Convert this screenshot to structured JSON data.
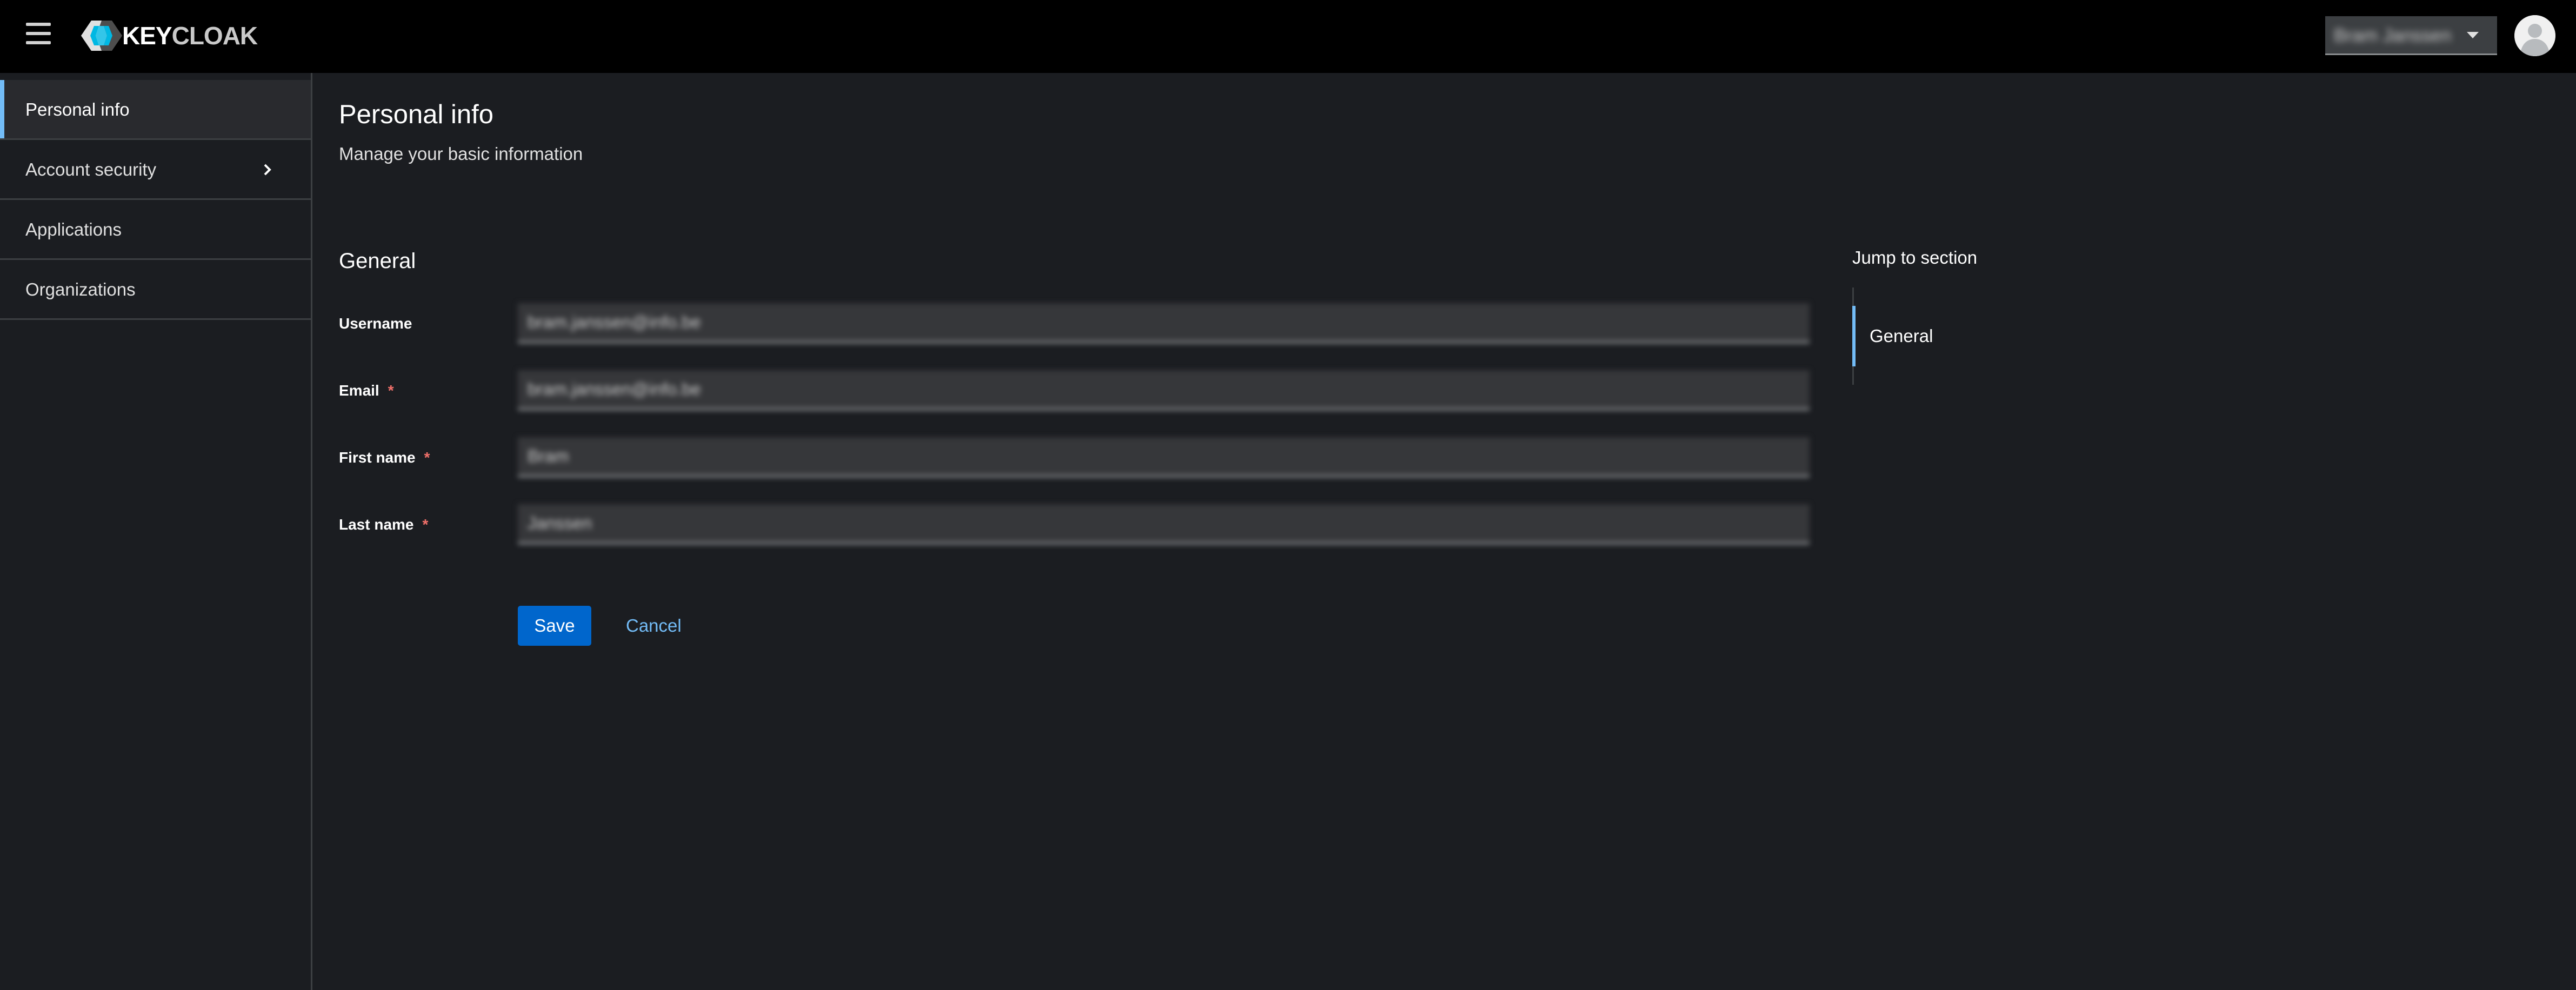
{
  "masthead": {
    "brand_text": "KEYCLOAK",
    "brand_text_primary": "KEY",
    "brand_text_secondary": "CLOAK",
    "menu_icon": "hamburger-icon",
    "user_name": "Bram Janssen",
    "user_caret_icon": "caret-down-icon",
    "avatar_icon": "user-avatar-icon"
  },
  "sidebar": {
    "items": [
      {
        "label": "Personal info",
        "active": true
      },
      {
        "label": "Account security",
        "has_children": true,
        "icon": "chevron-right-icon"
      },
      {
        "label": "Applications"
      },
      {
        "label": "Organizations"
      }
    ]
  },
  "main": {
    "title": "Personal info",
    "subtitle": "Manage your basic information",
    "section_title": "General",
    "fields": {
      "username": {
        "label": "Username",
        "value": "bram.janssen@info.be",
        "required": false
      },
      "email": {
        "label": "Email",
        "value": "bram.janssen@info.be",
        "required": true
      },
      "first_name": {
        "label": "First name",
        "value": "Bram",
        "required": true
      },
      "last_name": {
        "label": "Last name",
        "value": "Janssen",
        "required": true
      }
    },
    "required_marker": "*",
    "save_label": "Save",
    "cancel_label": "Cancel"
  },
  "jump_links": {
    "title": "Jump to section",
    "items": [
      {
        "label": "General",
        "active": true
      }
    ]
  },
  "colors": {
    "masthead_bg": "#000000",
    "page_bg": "#1b1d21",
    "nav_active_bg": "#292a2e",
    "accent_blue": "#73bcf7",
    "primary_button": "#0066cc",
    "required_red": "#f0706a",
    "input_bg": "#36373a"
  }
}
